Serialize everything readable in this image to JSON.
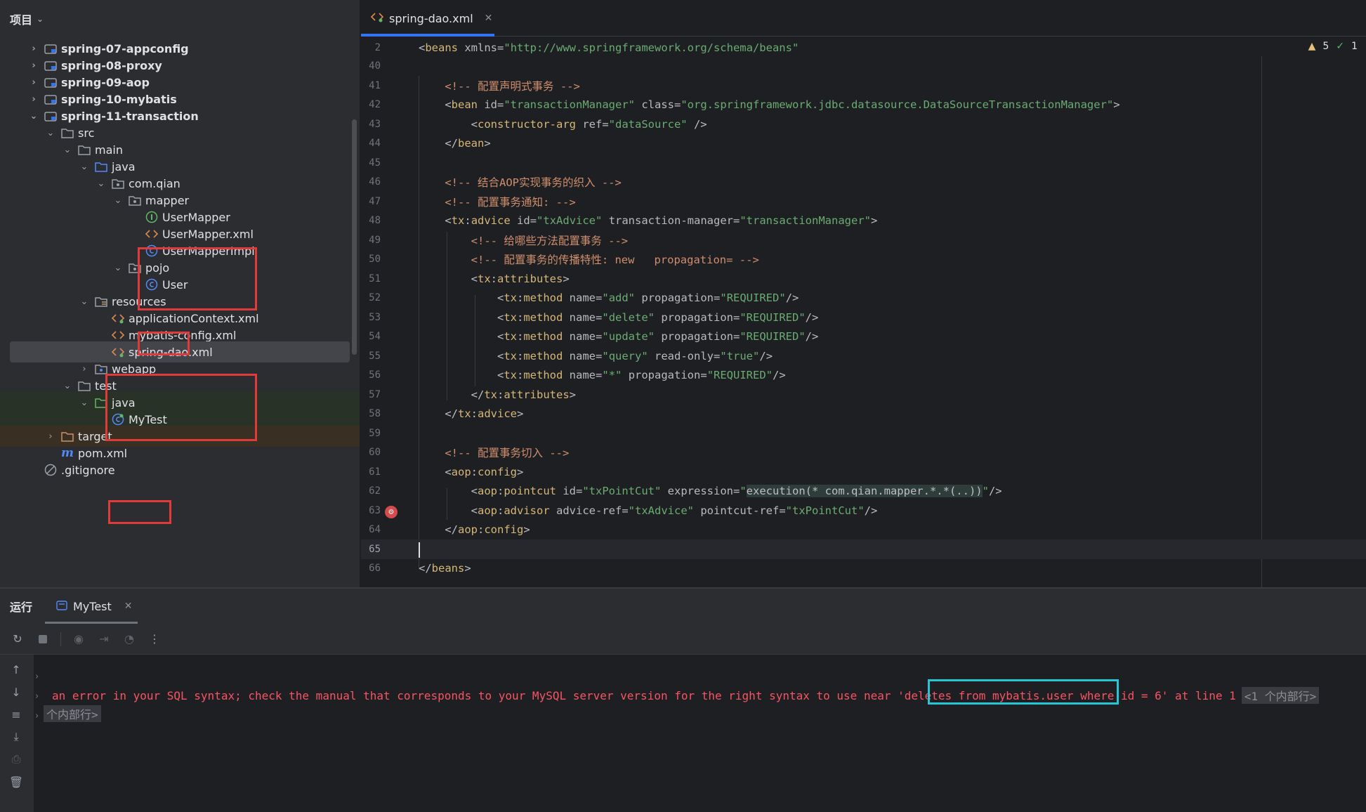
{
  "project_panel": {
    "title": "项目",
    "items": [
      {
        "label": "spring-07-appconfig"
      },
      {
        "label": "spring-08-proxy"
      },
      {
        "label": "spring-09-aop"
      },
      {
        "label": "spring-10-mybatis"
      },
      {
        "label": "spring-11-transaction"
      },
      {
        "label": "src"
      },
      {
        "label": "main"
      },
      {
        "label": "java"
      },
      {
        "label": "com.qian"
      },
      {
        "label": "mapper"
      },
      {
        "label": "UserMapper"
      },
      {
        "label": "UserMapper.xml"
      },
      {
        "label": "UserMapperImpl"
      },
      {
        "label": "pojo"
      },
      {
        "label": "User"
      },
      {
        "label": "resources"
      },
      {
        "label": "applicationContext.xml"
      },
      {
        "label": "mybatis-config.xml"
      },
      {
        "label": "spring-dao.xml"
      },
      {
        "label": "webapp"
      },
      {
        "label": "test"
      },
      {
        "label": "java"
      },
      {
        "label": "MyTest"
      },
      {
        "label": "target"
      },
      {
        "label": "pom.xml"
      },
      {
        "label": ".gitignore"
      }
    ]
  },
  "editor": {
    "tab_label": "spring-dao.xml",
    "inspections": {
      "warnings": "5",
      "ok": "1"
    },
    "lines": [
      {
        "n": "2",
        "parts": [
          [
            "t-txt",
            "<"
          ],
          [
            "t-tag",
            "beans"
          ],
          [
            "t-attr",
            " xmlns"
          ],
          [
            "t-txt",
            "="
          ],
          [
            "t-val",
            "\"http://www.springframework.org/schema/beans\""
          ]
        ]
      },
      {
        "n": "40",
        "parts": []
      },
      {
        "n": "41",
        "parts": [
          [
            "t-cmt",
            "    <!-- 配置声明式事务 -->"
          ]
        ]
      },
      {
        "n": "42",
        "parts": [
          [
            "t-txt",
            "    <"
          ],
          [
            "t-tag",
            "bean"
          ],
          [
            "t-attr",
            " id"
          ],
          [
            "t-txt",
            "="
          ],
          [
            "t-val",
            "\"transactionManager\""
          ],
          [
            "t-attr",
            " class"
          ],
          [
            "t-txt",
            "="
          ],
          [
            "t-val",
            "\"org.springframework.jdbc.datasource.DataSourceTransactionManager\""
          ],
          [
            "t-txt",
            ">"
          ]
        ]
      },
      {
        "n": "43",
        "parts": [
          [
            "t-txt",
            "        <"
          ],
          [
            "t-tag",
            "constructor-arg"
          ],
          [
            "t-attr",
            " ref"
          ],
          [
            "t-txt",
            "="
          ],
          [
            "t-val",
            "\"dataSource\""
          ],
          [
            "t-txt",
            " />"
          ]
        ]
      },
      {
        "n": "44",
        "parts": [
          [
            "t-txt",
            "    </"
          ],
          [
            "t-tag",
            "bean"
          ],
          [
            "t-txt",
            ">"
          ]
        ]
      },
      {
        "n": "45",
        "parts": []
      },
      {
        "n": "46",
        "parts": [
          [
            "t-cmt",
            "    <!-- 结合AOP实现事务的织入 -->"
          ]
        ]
      },
      {
        "n": "47",
        "parts": [
          [
            "t-cmt",
            "    <!-- 配置事务通知: -->"
          ]
        ]
      },
      {
        "n": "48",
        "parts": [
          [
            "t-txt",
            "    <"
          ],
          [
            "t-tag",
            "tx"
          ],
          [
            "t-txt",
            ":"
          ],
          [
            "t-tag",
            "advice"
          ],
          [
            "t-attr",
            " id"
          ],
          [
            "t-txt",
            "="
          ],
          [
            "t-val",
            "\"txAdvice\""
          ],
          [
            "t-attr",
            " transaction-manager"
          ],
          [
            "t-txt",
            "="
          ],
          [
            "t-val",
            "\"transactionManager\""
          ],
          [
            "t-txt",
            ">"
          ]
        ]
      },
      {
        "n": "49",
        "parts": [
          [
            "t-cmt",
            "        <!-- 给哪些方法配置事务 -->"
          ]
        ]
      },
      {
        "n": "50",
        "parts": [
          [
            "t-cmt",
            "        <!-- 配置事务的传播特性: new   propagation= -->"
          ]
        ]
      },
      {
        "n": "51",
        "parts": [
          [
            "t-txt",
            "        <"
          ],
          [
            "t-tag",
            "tx"
          ],
          [
            "t-txt",
            ":"
          ],
          [
            "t-tag",
            "attributes"
          ],
          [
            "t-txt",
            ">"
          ]
        ]
      },
      {
        "n": "52",
        "parts": [
          [
            "t-txt",
            "            <"
          ],
          [
            "t-tag",
            "tx"
          ],
          [
            "t-txt",
            ":"
          ],
          [
            "t-tag",
            "method"
          ],
          [
            "t-attr",
            " name"
          ],
          [
            "t-txt",
            "="
          ],
          [
            "t-val",
            "\"add\""
          ],
          [
            "t-attr",
            " propagation"
          ],
          [
            "t-txt",
            "="
          ],
          [
            "t-val",
            "\"REQUIRED\""
          ],
          [
            "t-txt",
            "/>"
          ]
        ]
      },
      {
        "n": "53",
        "parts": [
          [
            "t-txt",
            "            <"
          ],
          [
            "t-tag",
            "tx"
          ],
          [
            "t-txt",
            ":"
          ],
          [
            "t-tag",
            "method"
          ],
          [
            "t-attr",
            " name"
          ],
          [
            "t-txt",
            "="
          ],
          [
            "t-val",
            "\"delete\""
          ],
          [
            "t-attr",
            " propagation"
          ],
          [
            "t-txt",
            "="
          ],
          [
            "t-val",
            "\"REQUIRED\""
          ],
          [
            "t-txt",
            "/>"
          ]
        ]
      },
      {
        "n": "54",
        "parts": [
          [
            "t-txt",
            "            <"
          ],
          [
            "t-tag",
            "tx"
          ],
          [
            "t-txt",
            ":"
          ],
          [
            "t-tag",
            "method"
          ],
          [
            "t-attr",
            " name"
          ],
          [
            "t-txt",
            "="
          ],
          [
            "t-val",
            "\"update\""
          ],
          [
            "t-attr",
            " propagation"
          ],
          [
            "t-txt",
            "="
          ],
          [
            "t-val",
            "\"REQUIRED\""
          ],
          [
            "t-txt",
            "/>"
          ]
        ]
      },
      {
        "n": "55",
        "parts": [
          [
            "t-txt",
            "            <"
          ],
          [
            "t-tag",
            "tx"
          ],
          [
            "t-txt",
            ":"
          ],
          [
            "t-tag",
            "method"
          ],
          [
            "t-attr",
            " name"
          ],
          [
            "t-txt",
            "="
          ],
          [
            "t-val",
            "\"query\""
          ],
          [
            "t-attr",
            " read-only"
          ],
          [
            "t-txt",
            "="
          ],
          [
            "t-val",
            "\"true\""
          ],
          [
            "t-txt",
            "/>"
          ]
        ]
      },
      {
        "n": "56",
        "parts": [
          [
            "t-txt",
            "            <"
          ],
          [
            "t-tag",
            "tx"
          ],
          [
            "t-txt",
            ":"
          ],
          [
            "t-tag",
            "method"
          ],
          [
            "t-attr",
            " name"
          ],
          [
            "t-txt",
            "="
          ],
          [
            "t-val",
            "\"*\""
          ],
          [
            "t-attr",
            " propagation"
          ],
          [
            "t-txt",
            "="
          ],
          [
            "t-val",
            "\"REQUIRED\""
          ],
          [
            "t-txt",
            "/>"
          ]
        ]
      },
      {
        "n": "57",
        "parts": [
          [
            "t-txt",
            "        </"
          ],
          [
            "t-tag",
            "tx"
          ],
          [
            "t-txt",
            ":"
          ],
          [
            "t-tag",
            "attributes"
          ],
          [
            "t-txt",
            ">"
          ]
        ]
      },
      {
        "n": "58",
        "parts": [
          [
            "t-txt",
            "    </"
          ],
          [
            "t-tag",
            "tx"
          ],
          [
            "t-txt",
            ":"
          ],
          [
            "t-tag",
            "advice"
          ],
          [
            "t-txt",
            ">"
          ]
        ]
      },
      {
        "n": "59",
        "parts": []
      },
      {
        "n": "60",
        "parts": [
          [
            "t-cmt",
            "    <!-- 配置事务切入 -->"
          ]
        ]
      },
      {
        "n": "61",
        "parts": [
          [
            "t-txt",
            "    <"
          ],
          [
            "t-tag",
            "aop"
          ],
          [
            "t-txt",
            ":"
          ],
          [
            "t-tag",
            "config"
          ],
          [
            "t-txt",
            ">"
          ]
        ]
      },
      {
        "n": "62",
        "parts": [
          [
            "t-txt",
            "        <"
          ],
          [
            "t-tag",
            "aop"
          ],
          [
            "t-txt",
            ":"
          ],
          [
            "t-tag",
            "pointcut"
          ],
          [
            "t-attr",
            " id"
          ],
          [
            "t-txt",
            "="
          ],
          [
            "t-val",
            "\"txPointCut\""
          ],
          [
            "t-attr",
            " expression"
          ],
          [
            "t-txt",
            "="
          ],
          [
            "t-val",
            "\""
          ],
          [
            "t-hl",
            "execution(* com.qian.mapper.*.*(..))"
          ],
          [
            "t-val",
            "\""
          ],
          [
            "t-txt",
            "/>"
          ]
        ]
      },
      {
        "n": "63",
        "parts": [
          [
            "t-txt",
            "        <"
          ],
          [
            "t-tag",
            "aop"
          ],
          [
            "t-txt",
            ":"
          ],
          [
            "t-tag",
            "advisor"
          ],
          [
            "t-attr",
            " advice-ref"
          ],
          [
            "t-txt",
            "="
          ],
          [
            "t-val",
            "\"txAdvice\""
          ],
          [
            "t-attr",
            " pointcut-ref"
          ],
          [
            "t-txt",
            "="
          ],
          [
            "t-val",
            "\"txPointCut\""
          ],
          [
            "t-txt",
            "/>"
          ]
        ]
      },
      {
        "n": "64",
        "parts": [
          [
            "t-txt",
            "    </"
          ],
          [
            "t-tag",
            "aop"
          ],
          [
            "t-txt",
            ":"
          ],
          [
            "t-tag",
            "config"
          ],
          [
            "t-txt",
            ">"
          ]
        ]
      },
      {
        "n": "65",
        "parts": []
      },
      {
        "n": "66",
        "parts": [
          [
            "t-txt",
            "</"
          ],
          [
            "t-tag",
            "beans"
          ],
          [
            "t-txt",
            ">"
          ]
        ]
      }
    ]
  },
  "run_panel": {
    "title": "运行",
    "tab_label": "MyTest",
    "console": {
      "error_text": "an error in your SQL syntax; check the manual that corresponds to your MySQL server version for the right syntax to use near ",
      "error_highlight": "'deletes from mybatis.user where id = 6' at line 1",
      "fold_1": "<1 个内部行>",
      "fold_2": "个内部行>"
    }
  }
}
